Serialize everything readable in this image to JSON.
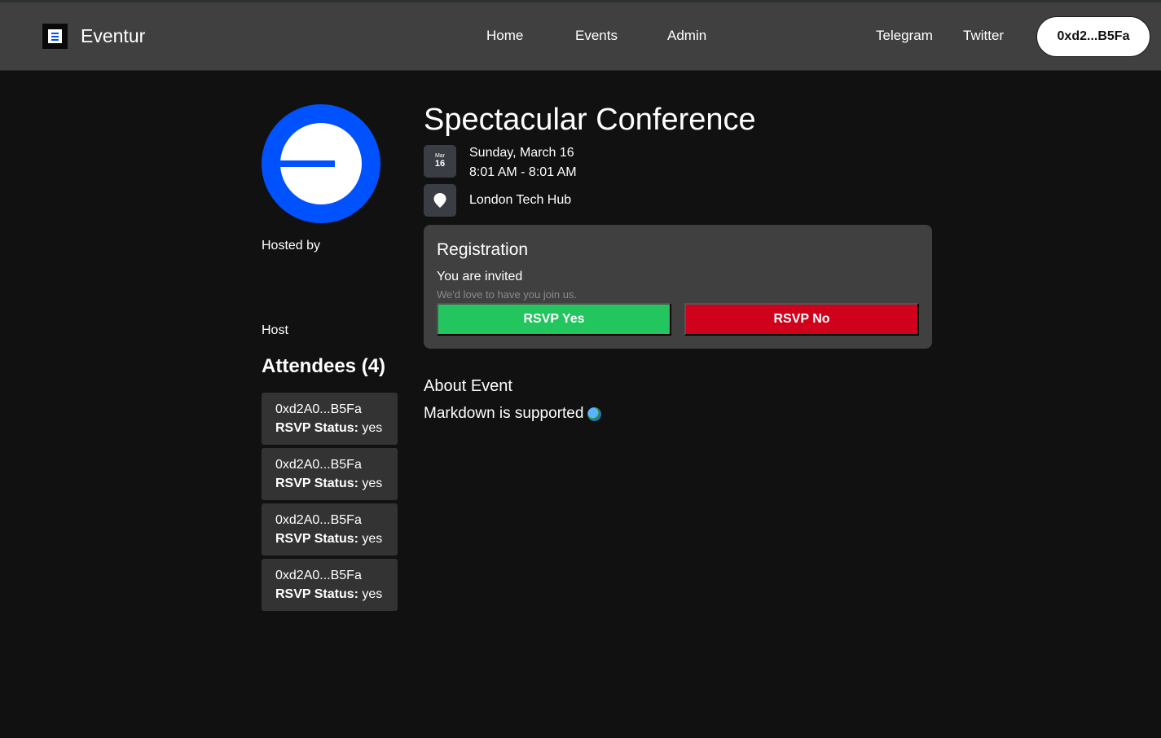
{
  "brand": {
    "name": "Eventur",
    "logo_icon": "eventur-logo-icon"
  },
  "nav": {
    "links": [
      "Home",
      "Events",
      "Admin"
    ],
    "social": [
      "Telegram",
      "Twitter"
    ],
    "wallet": "0xd2...B5Fa"
  },
  "host": {
    "hosted_by_label": "Hosted by",
    "host_label": "Host"
  },
  "attendees": {
    "title": "Attendees (4)",
    "status_label": "RSVP Status:",
    "items": [
      {
        "address": "0xd2A0...B5Fa",
        "status": "yes"
      },
      {
        "address": "0xd2A0...B5Fa",
        "status": "yes"
      },
      {
        "address": "0xd2A0...B5Fa",
        "status": "yes"
      },
      {
        "address": "0xd2A0...B5Fa",
        "status": "yes"
      }
    ]
  },
  "event": {
    "title": "Spectacular Conference",
    "month_short": "Mar",
    "day": "16",
    "date": "Sunday, March 16",
    "time": "8:01 AM - 8:01 AM",
    "location": "London Tech Hub"
  },
  "registration": {
    "title": "Registration",
    "subtitle": "You are invited",
    "hint": "We'd love to have you join us.",
    "rsvp_yes": "RSVP Yes",
    "rsvp_no": "RSVP No"
  },
  "about": {
    "title": "About Event",
    "body": "Markdown is supported"
  },
  "colors": {
    "accent_blue": "#0052ff",
    "rsvp_yes": "#22c55e",
    "rsvp_no": "#d0021b",
    "navbar": "#404040",
    "background": "#111111"
  }
}
